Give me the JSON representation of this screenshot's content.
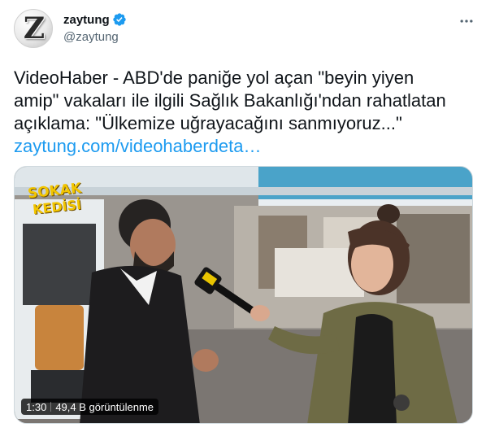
{
  "tweet": {
    "author": {
      "display_name": "zaytung",
      "handle": "@zaytung",
      "avatar_letter": "Z",
      "verified": true
    },
    "text_lines": [
      "VideoHaber - ABD'de paniğe yol açan \"beyin yiyen",
      "amip\" vakaları ile ilgili Sağlık Bakanlığı'ndan rahatlatan",
      "açıklama: \"Ülkemize uğrayacağını sanmıyoruz...\""
    ],
    "link_text": "zaytung.com/videohaberdeta…",
    "media": {
      "duration": "1:30",
      "views": "49,4 B görüntülenme",
      "watermark_line1": "SOKAK",
      "watermark_line2": "KEDİSİ"
    }
  },
  "colors": {
    "link": "#1d9bf0",
    "secondary_text": "#536471",
    "verified_badge": "#1d9bf0",
    "watermark": "#f2c500"
  },
  "icons": [
    "verified-badge-icon",
    "more-options-icon"
  ]
}
